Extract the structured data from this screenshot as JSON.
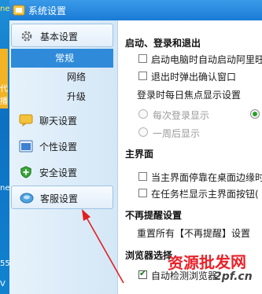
{
  "desktop": {
    "text_a": "ne",
    "text_b": "代",
    "text_c": "播",
    "text_d": "ne",
    "text_e": "55",
    "text_f": "V"
  },
  "window": {
    "title": "系统设置"
  },
  "sidebar": {
    "items": [
      {
        "label": "基本设置",
        "icon": "gear-icon"
      },
      {
        "label": "聊天设置",
        "icon": "chat-icon"
      },
      {
        "label": "个性设置",
        "icon": "personalize-icon"
      },
      {
        "label": "安全设置",
        "icon": "shield-icon"
      },
      {
        "label": "客服设置",
        "icon": "service-icon"
      }
    ],
    "sub_items": [
      "常规",
      "网络",
      "升级"
    ]
  },
  "main": {
    "section1": {
      "title": "启动、登录和退出",
      "auto_start": "启动电脑时自动启动阿里旺",
      "exit_confirm": "退出时弹出确认窗口",
      "focus_label": "登录时每日焦点显示设置",
      "radio_each": "每次登录显示",
      "radio_week": "一周后显示"
    },
    "section2": {
      "title": "主界面",
      "dock_edge": "当主界面停靠在桌面边缘时",
      "taskbar_btn": "在任务栏显示主界面按钮("
    },
    "section3": {
      "title": "不再提醒设置",
      "reset_text": "重置所有【不再提醒】设置"
    },
    "section4": {
      "title": "浏览器选择",
      "auto_detect": "自动检测浏览器"
    }
  },
  "watermark": {
    "brand": "资源批发网",
    "url": "2pf.cn"
  },
  "colors": {
    "accent": "#2f8bd9",
    "arrow": "#e02020",
    "watermark": "#e8232b"
  }
}
